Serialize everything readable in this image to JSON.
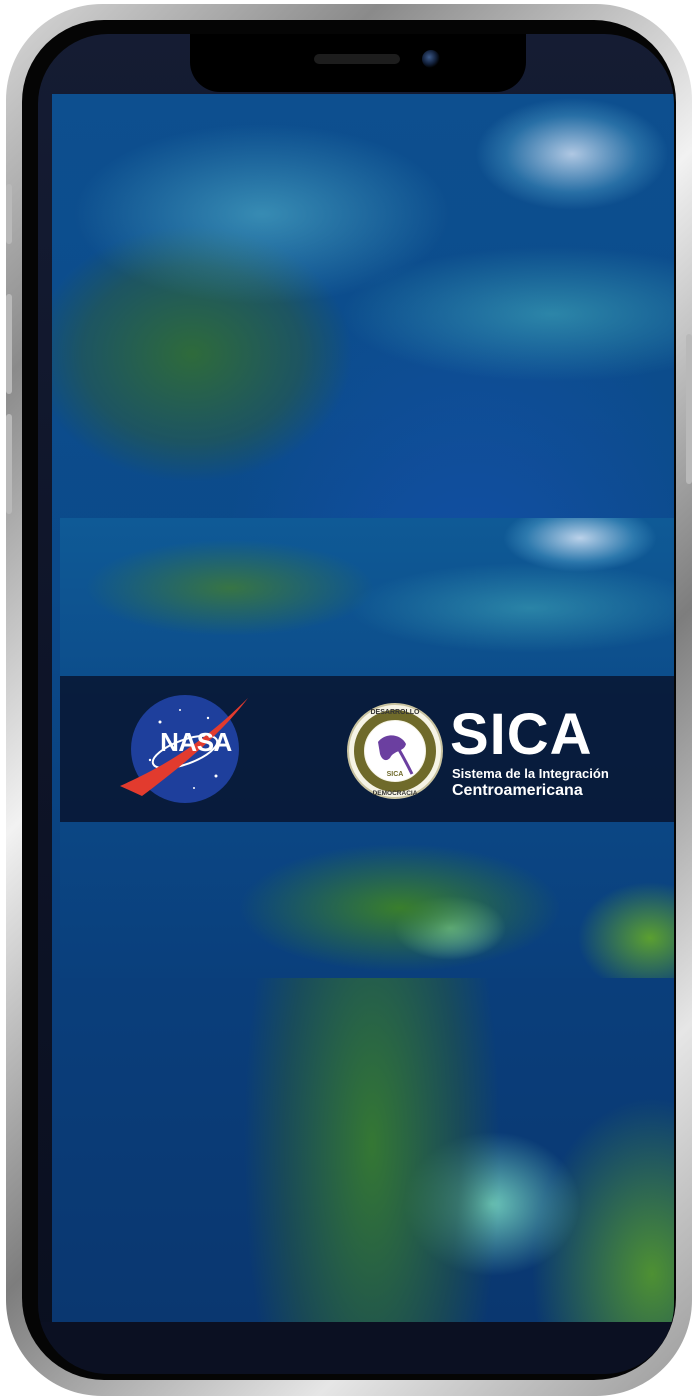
{
  "banner": {
    "nasa": {
      "wordmark": "NASA"
    },
    "sica": {
      "title": "SICA",
      "subtitle_line1": "Sistema de la Integración",
      "subtitle_line2": "Centroamericana",
      "seal": {
        "top": "DESARROLLO",
        "left": "PAZ",
        "right": "LIBERTAD",
        "bottom": "DEMOCRACIA",
        "center": "SICA",
        "ring_text": "SISTEMA DE LA INTEGRACION CENTROAMERICANA"
      }
    }
  },
  "colors": {
    "ocean": "#0b4a8a",
    "strip": "#08102a",
    "nasa_blue": "#1e3f9c",
    "nasa_red": "#e23b2e",
    "seal_olive": "#6f6a2a"
  },
  "icons": [
    "nasa-meatball-logo-icon",
    "sica-seal-icon"
  ]
}
